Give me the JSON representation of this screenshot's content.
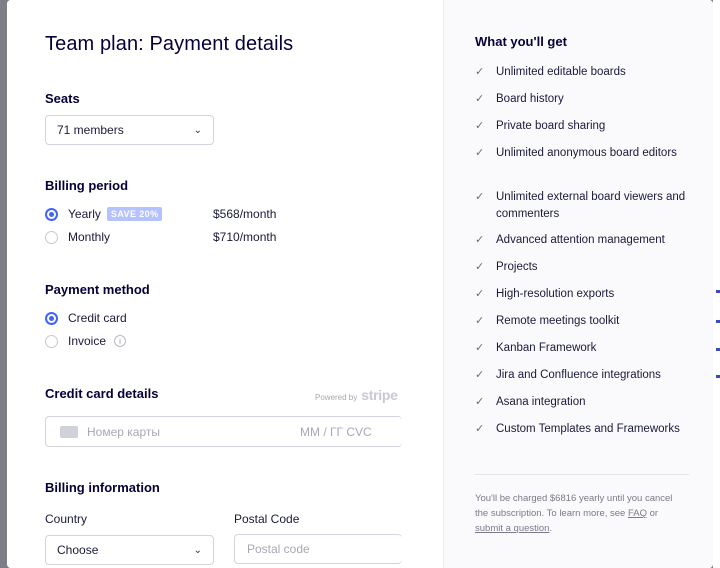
{
  "title": "Team plan: Payment details",
  "seats": {
    "label": "Seats",
    "value": "71 members"
  },
  "billing_period": {
    "label": "Billing period",
    "options": [
      {
        "label": "Yearly",
        "badge": "SAVE 20%",
        "price": "$568/month",
        "selected": true
      },
      {
        "label": "Monthly",
        "price": "$710/month",
        "selected": false
      }
    ]
  },
  "payment_method": {
    "label": "Payment method",
    "options": [
      {
        "label": "Credit card",
        "selected": true
      },
      {
        "label": "Invoice",
        "selected": false
      }
    ]
  },
  "card": {
    "label": "Credit card details",
    "powered_by": "Powered by",
    "brand": "stripe",
    "number_placeholder": "Номер карты",
    "expiry_cvc_placeholder": "ММ / ГГ  CVC"
  },
  "billing_info": {
    "label": "Billing information",
    "country_label": "Country",
    "country_value": "Choose",
    "postal_label": "Postal Code",
    "postal_placeholder": "Postal code"
  },
  "benefits": {
    "title": "What you'll get",
    "items": [
      "Unlimited editable boards",
      "Board history",
      "Private board sharing",
      "Unlimited anonymous board editors",
      "Unlimited external board viewers and commenters",
      "Advanced attention management",
      "Projects",
      "High-resolution exports",
      "Remote meetings toolkit",
      "Kanban Framework",
      "Jira and Confluence integrations",
      "Asana integration",
      "Custom Templates and Frameworks"
    ],
    "note_text": "You'll be charged $6816 yearly until you cancel the subscription. To learn more, see",
    "faq_link": "FAQ",
    "note_or": "or",
    "question_link": "submit a question",
    "note_end": "."
  },
  "colors": {
    "accent": "#4262ff",
    "badge": "#b4c2ff",
    "text": "#050038"
  }
}
